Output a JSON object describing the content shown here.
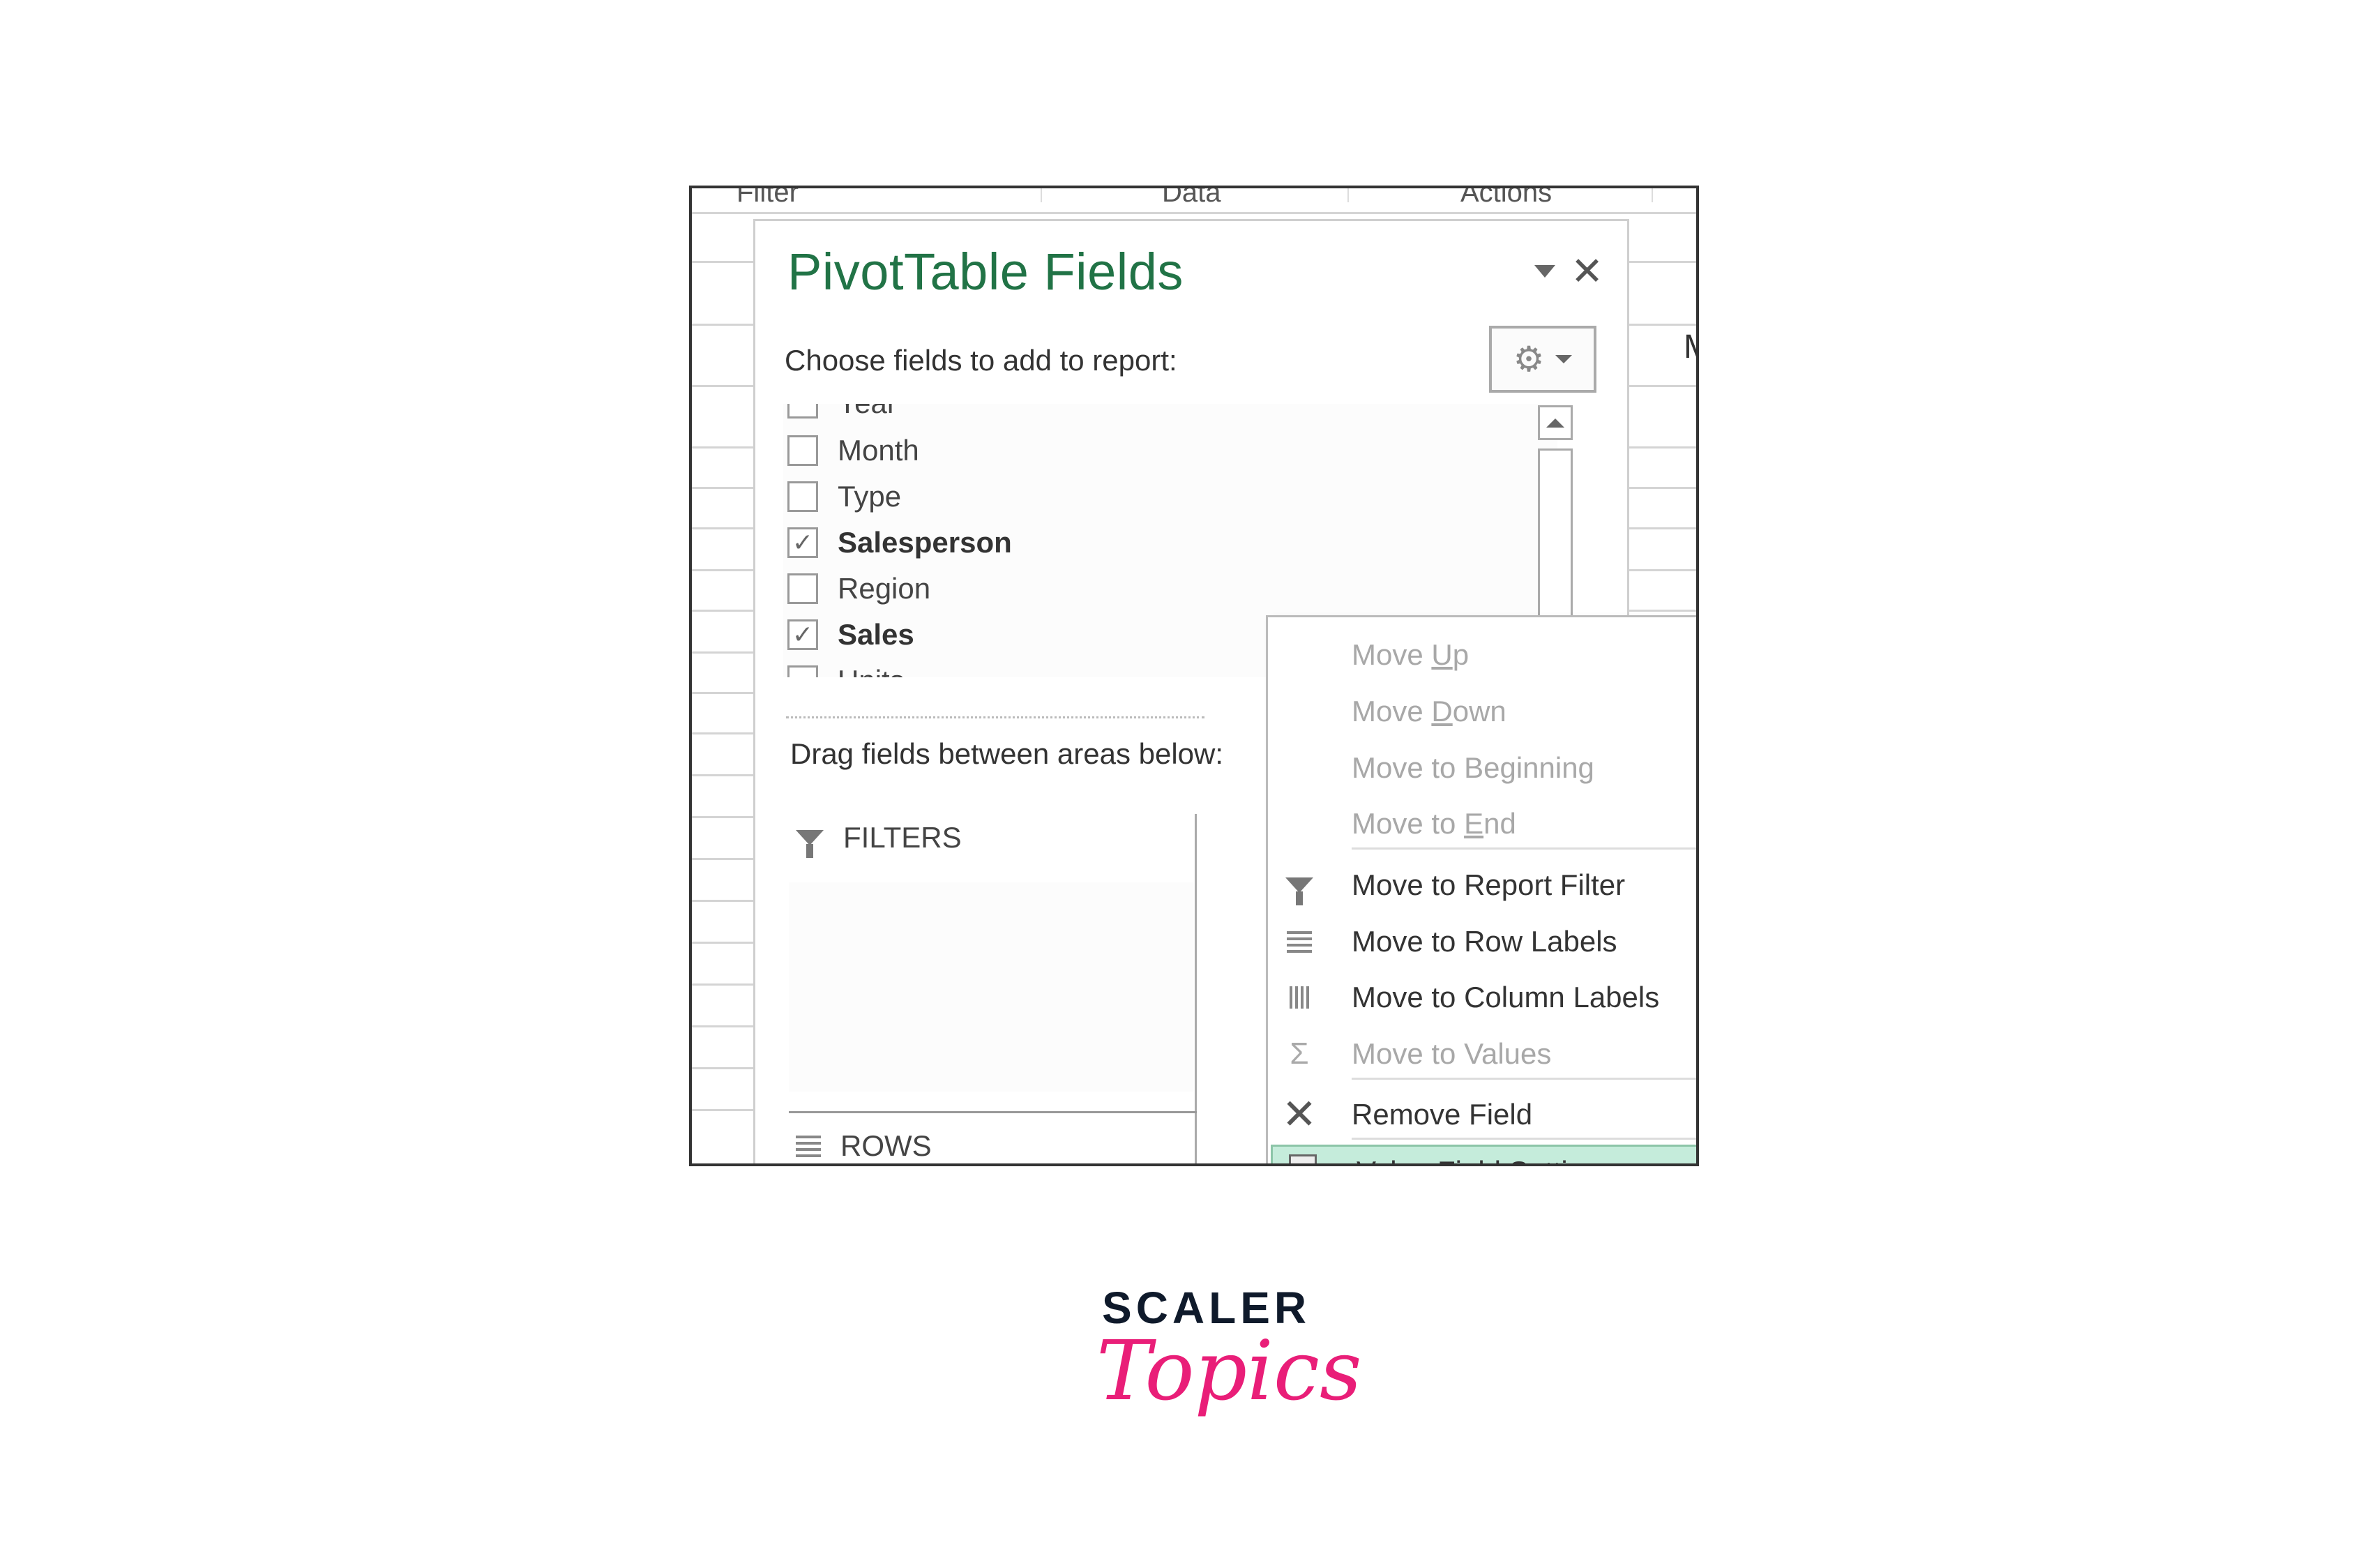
{
  "background_sheet": {
    "ribbon_groups": [
      "Filter",
      "Data",
      "Actions"
    ],
    "cell_fragment": "M"
  },
  "pane": {
    "title": "PivotTable Fields",
    "dropdown_icon": "caret-down-icon",
    "close_icon": "close-icon",
    "close_glyph": "✕",
    "choose_label": "Choose fields to add to report:",
    "tools_button": {
      "icon": "gear-icon",
      "glyph": "⚙"
    },
    "fields": [
      {
        "label": "Year",
        "checked": false,
        "bold": false
      },
      {
        "label": "Month",
        "checked": false,
        "bold": false
      },
      {
        "label": "Type",
        "checked": false,
        "bold": false
      },
      {
        "label": "Salesperson",
        "checked": true,
        "bold": true
      },
      {
        "label": "Region",
        "checked": false,
        "bold": false
      },
      {
        "label": "Sales",
        "checked": true,
        "bold": true
      },
      {
        "label": "Units",
        "checked": false,
        "bold": false
      }
    ],
    "check_glyph": "✓",
    "drag_text": "Drag fields between areas below:",
    "areas": {
      "filters_label": "FILTERS",
      "rows_label": "ROWS"
    }
  },
  "context_menu": {
    "items": [
      {
        "label_pre": "Move ",
        "accel": "U",
        "label_post": "p",
        "disabled": true,
        "icon": ""
      },
      {
        "label_pre": "Move ",
        "accel": "D",
        "label_post": "own",
        "disabled": true,
        "icon": ""
      },
      {
        "label_pre": "Move to Be",
        "accel": "g",
        "label_post": "inning",
        "disabled": true,
        "icon": ""
      },
      {
        "label_pre": "Move to ",
        "accel": "E",
        "label_post": "nd",
        "disabled": true,
        "icon": ""
      },
      {
        "label_pre": "Move to Report Filter",
        "accel": "",
        "label_post": "",
        "disabled": false,
        "icon": "filter-icon"
      },
      {
        "label_pre": "Move to Row Labels",
        "accel": "",
        "label_post": "",
        "disabled": false,
        "icon": "row-labels-icon"
      },
      {
        "label_pre": "Move to Column Labels",
        "accel": "",
        "label_post": "",
        "disabled": false,
        "icon": "column-labels-icon"
      },
      {
        "label_pre": "Move to Values",
        "accel": "",
        "label_post": "",
        "disabled": true,
        "icon": "sigma-icon",
        "glyph": "Σ"
      },
      {
        "label_pre": "Remove Field",
        "accel": "",
        "label_post": "",
        "disabled": false,
        "icon": "remove-x-icon",
        "glyph": "✕"
      },
      {
        "label_pre": "Value Field Setti",
        "accel": "n",
        "label_post": "gs...",
        "disabled": false,
        "highlighted": true,
        "icon": "value-field-settings-icon",
        "glyph": "i"
      }
    ]
  },
  "logo": {
    "line1": "SCALER",
    "line2": "Topics",
    "colors": {
      "scaler": "#0f1a2b",
      "topics": "#e91e78"
    }
  },
  "colors": {
    "title_green": "#217346",
    "highlight_bg": "#c5ecdb",
    "highlight_border": "#8cc5a8"
  }
}
